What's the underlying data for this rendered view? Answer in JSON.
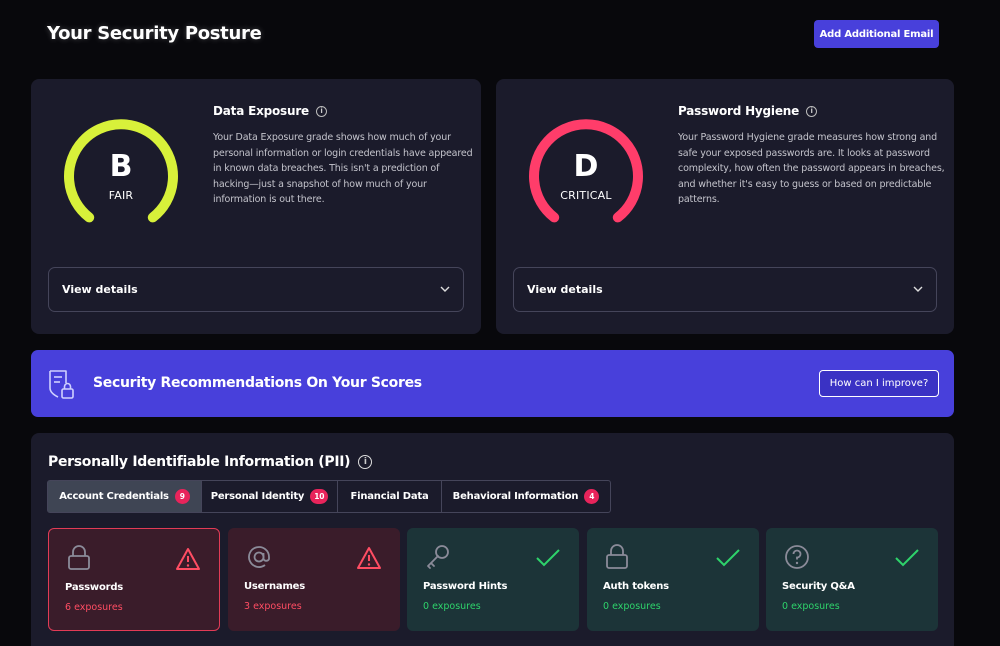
{
  "header": {
    "title": "Your Security Posture",
    "add_email_label": "Add Additional Email"
  },
  "data_exposure": {
    "grade": "B",
    "grade_label": "FAIR",
    "gauge_color": "#d8f13a",
    "heading": "Data Exposure",
    "description": "Your Data Exposure grade shows how much of your personal information or login credentials have appeared in known data breaches. This isn't a prediction of hacking—just a snapshot of how much of your information is out there.",
    "details_label": "View details"
  },
  "password_hygiene": {
    "grade": "D",
    "grade_label": "CRITICAL",
    "gauge_color": "#ff3d6a",
    "heading": "Password Hygiene",
    "description": "Your Password Hygiene grade measures how strong and safe your exposed passwords are. It looks at password complexity, how often the password appears in breaches, and whether it's easy to guess or based on predictable patterns.",
    "details_label": "View details"
  },
  "recommendations": {
    "title": "Security Recommendations On Your Scores",
    "button_label": "How can I improve?"
  },
  "pii": {
    "title": "Personally Identifiable Information (PII)",
    "tabs": [
      {
        "label": "Account Credentials",
        "badge": "9"
      },
      {
        "label": "Personal Identity",
        "badge": "10"
      },
      {
        "label": "Financial Data",
        "badge": ""
      },
      {
        "label": "Behavioral Information",
        "badge": "4"
      }
    ],
    "tiles": [
      {
        "name": "Passwords",
        "count": "6 exposures",
        "status": "warning",
        "icon": "lock-icon"
      },
      {
        "name": "Usernames",
        "count": "3 exposures",
        "status": "warning",
        "icon": "at-sign-icon"
      },
      {
        "name": "Password Hints",
        "count": "0 exposures",
        "status": "ok",
        "icon": "key-icon"
      },
      {
        "name": "Auth tokens",
        "count": "0 exposures",
        "status": "ok",
        "icon": "lock-icon"
      },
      {
        "name": "Security Q&A",
        "count": "0 exposures",
        "status": "ok",
        "icon": "question-circle-icon"
      }
    ]
  },
  "colors": {
    "accent": "#4840db",
    "warning": "#ff4d63",
    "ok": "#2ed36b"
  }
}
